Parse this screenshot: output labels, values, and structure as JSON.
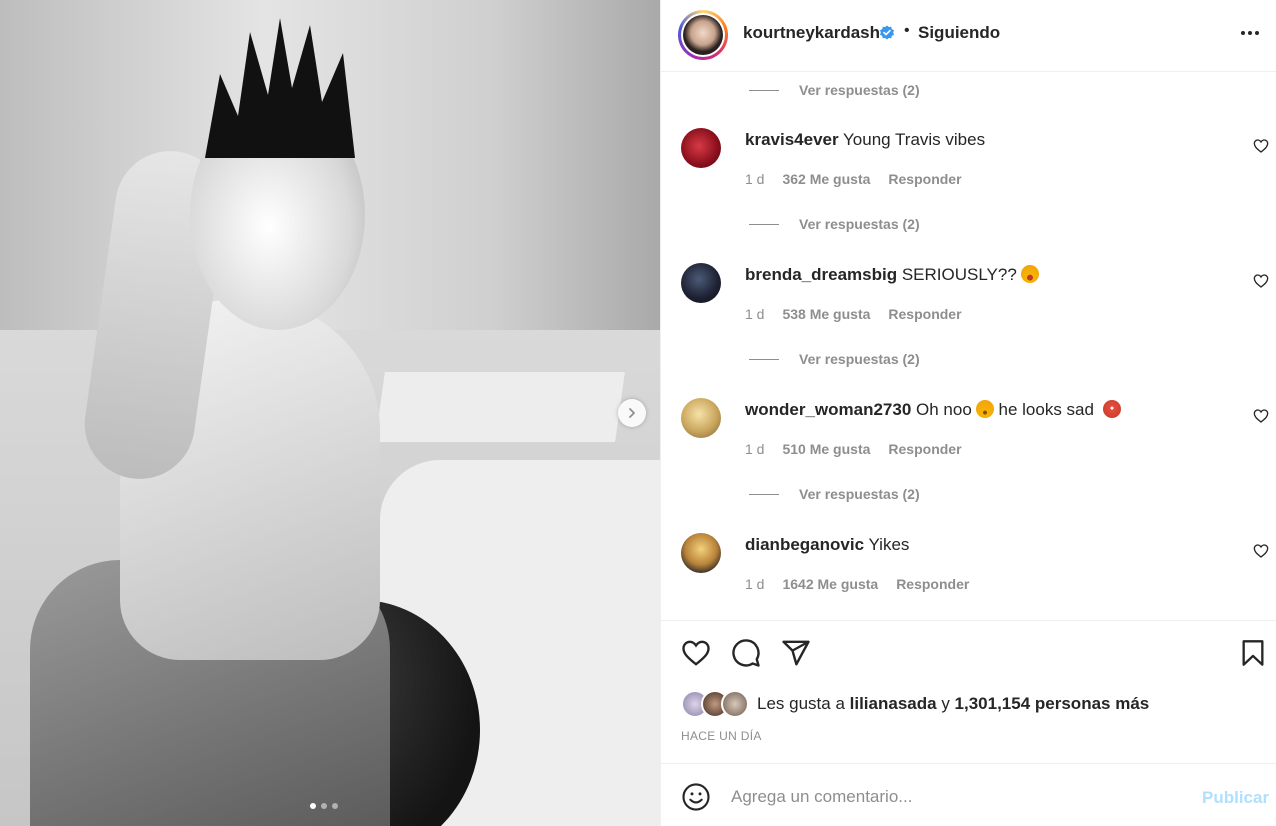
{
  "post": {
    "image_alt": "",
    "carousel": {
      "count": 3,
      "active": 1
    }
  },
  "header": {
    "username": "kourtneykardash",
    "separator": "•",
    "following_label": "Siguiendo"
  },
  "comments": {
    "view_replies_top": "Ver respuestas (2)",
    "items": [
      {
        "username": "kravis4ever",
        "text": "Young Travis vibes",
        "emoji": "",
        "time": "1 d",
        "likes": "362 Me gusta",
        "reply": "Responder",
        "view_replies": "Ver respuestas (2)"
      },
      {
        "username": "brenda_dreamsbig",
        "text": "SERIOUSLY??",
        "emoji": "astonished-emoji",
        "time": "1 d",
        "likes": "538 Me gusta",
        "reply": "Responder",
        "view_replies": "Ver respuestas (2)"
      },
      {
        "username": "wonder_woman2730",
        "text": "Oh noo",
        "text2": " he looks sad ",
        "emoji": "worried-emoji",
        "emoji2": "angry-emoji",
        "time": "1 d",
        "likes": "510 Me gusta",
        "reply": "Responder",
        "view_replies": "Ver respuestas (2)"
      },
      {
        "username": "dianbeganovic",
        "text": "Yikes",
        "emoji": "",
        "time": "1 d",
        "likes": "1642 Me gusta",
        "reply": "Responder"
      }
    ]
  },
  "likes": {
    "prefix": "Les gusta a",
    "user": "lilianasada",
    "conj": "y",
    "count": "1,301,154 personas más"
  },
  "time_ago": "HACE UN DÍA",
  "add_comment": {
    "placeholder": "Agrega un comentario...",
    "publish_label": "Publicar"
  },
  "colors": {
    "verified": "#3897f0",
    "publish_disabled": "#b2dffc",
    "muted": "#8e8e8e"
  }
}
